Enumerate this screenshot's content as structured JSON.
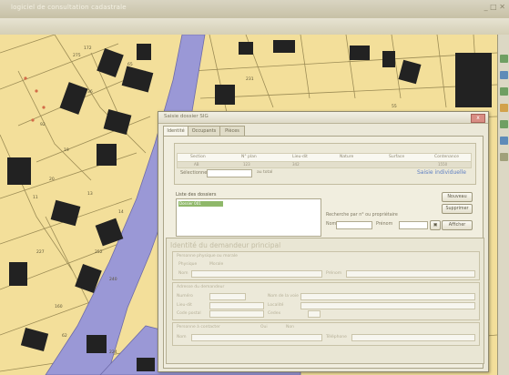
{
  "window": {
    "title": "logiciel de consultation cadastrale",
    "controls": "_ □ ✕"
  },
  "dialog": {
    "title": "Saisie dossier SIG",
    "close_label": "x",
    "tabs": [
      {
        "label": "Identité"
      },
      {
        "label": "Occupants"
      },
      {
        "label": "Pièces"
      }
    ],
    "columns": [
      "Section",
      "N° plan",
      "Lieu-dit",
      "Nature",
      "Surface",
      "Contenance"
    ],
    "row_values": [
      "AB",
      "123",
      "342",
      "",
      "",
      "1550"
    ],
    "select_label": "Sélectionner",
    "select_mid": "au total",
    "link_label": "Saisie individuelle",
    "list_label": "Liste des dossiers",
    "list_selected": "Dossier 001",
    "buttons": {
      "nouveau": "Nouveau",
      "supprimer": "Supprimer",
      "afficher": "Afficher"
    },
    "p_label": "Recherche par n° ou propriétaire",
    "p_row_l1": "Nom",
    "p_row_l2": "Prénom",
    "identity": {
      "heading": "Identité du demandeur principal",
      "sub1_title": "Personne physique ou morale",
      "radio1": "Physique",
      "radio2": "Morale",
      "field_nom": "Nom",
      "field_prenom": "Prénom",
      "sub2_title": "Adresse du demandeur",
      "f_numero": "Numéro",
      "f_voie": "Nom de la voie",
      "f_lieu": "Lieu-dit",
      "f_localite": "Localité",
      "f_cp": "Code postal",
      "f_cedex": "Cedex",
      "sub3_title": "Personne à contacter",
      "radio3": "Oui",
      "radio4": "Non",
      "f_nom2": "Nom",
      "f_tel": "Téléphone"
    }
  },
  "map": {
    "parcel_numbers": [
      "275",
      "172",
      "36",
      "65",
      "92",
      "19",
      "20",
      "11",
      "13",
      "14",
      "252",
      "227",
      "240",
      "160",
      "62",
      "224",
      "231",
      "55"
    ]
  }
}
